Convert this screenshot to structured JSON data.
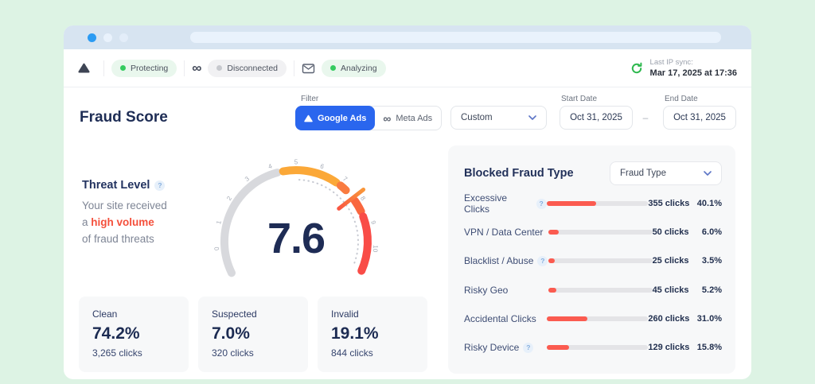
{
  "ui": {
    "help_glyph": "?"
  },
  "header": {
    "google": {
      "label": "Protecting"
    },
    "meta": {
      "label": "Disconnected"
    },
    "email": {
      "label": "Analyzing"
    },
    "sync": {
      "label": "Last IP sync:",
      "value": "Mar 17, 2025 at 17:36"
    }
  },
  "toolbar": {
    "title": "Fraud Score",
    "filter_label": "Filter",
    "tabs": [
      {
        "label": "Google Ads"
      },
      {
        "label": "Meta Ads"
      }
    ],
    "range": "Custom",
    "start_date": {
      "label": "Start Date",
      "value": "Oct 31, 2025"
    },
    "date_separator": "–",
    "end_date": {
      "label": "End Date",
      "value": "Oct 31, 2025"
    }
  },
  "threat": {
    "title": "Threat Level",
    "line1": "Your site received",
    "line2_prefix": "a",
    "line2_highlight": "high volume",
    "line3": "of fraud threats"
  },
  "gauge": {
    "value": "7.6",
    "min": 0,
    "max": 10,
    "tick_labels": [
      "0",
      "1",
      "2",
      "3",
      "4",
      "5",
      "6",
      "7",
      "8",
      "9",
      "10"
    ],
    "segments": [
      {
        "from": -1.1,
        "to": 4.2,
        "color": "#d8d9dd"
      },
      {
        "from": 4.45,
        "to": 6.8,
        "color": "#fba838"
      },
      {
        "from": 7.02,
        "to": 7.32,
        "color": "#f97b40"
      },
      {
        "from": 7.9,
        "to": 8.42,
        "color": "#f9673e"
      },
      {
        "from": 8.65,
        "to": 11.0,
        "color": "#f94c47"
      }
    ],
    "dotted": {
      "from": 5.15,
      "to": 10.9,
      "radius": 78
    },
    "needle": {
      "at": 7.75,
      "inner_color": "#f95642",
      "outer_color": "#f9973a"
    },
    "value_color": "#1e2c55"
  },
  "stats": [
    {
      "label": "Clean",
      "pct": "74.2%",
      "clicks": "3,265 clicks"
    },
    {
      "label": "Suspected",
      "pct": "7.0%",
      "clicks": "320 clicks"
    },
    {
      "label": "Invalid",
      "pct": "19.1%",
      "clicks": "844 clicks"
    }
  ],
  "fraud_panel": {
    "title": "Blocked Fraud Type",
    "dropdown": "Fraud Type",
    "bar_color": "#fb5b50",
    "rows": [
      {
        "label": "Excessive Clicks",
        "help": true,
        "clicks": "355 clicks",
        "pct": "40.1%",
        "fill_pct": 49
      },
      {
        "label": "VPN / Data Center",
        "help": false,
        "clicks": "50 clicks",
        "pct": "6.0%",
        "fill_pct": 10
      },
      {
        "label": "Blacklist / Abuse",
        "help": true,
        "clicks": "25 clicks",
        "pct": "3.5%",
        "fill_pct": 6
      },
      {
        "label": "Risky Geo",
        "help": false,
        "clicks": "45 clicks",
        "pct": "5.2%",
        "fill_pct": 8
      },
      {
        "label": "Accidental Clicks",
        "help": false,
        "clicks": "260 clicks",
        "pct": "31.0%",
        "fill_pct": 40
      },
      {
        "label": "Risky Device",
        "help": true,
        "clicks": "129 clicks",
        "pct": "15.8%",
        "fill_pct": 22
      }
    ]
  },
  "chart_data": [
    {
      "type": "gauge",
      "title": "Threat Level / Fraud Score",
      "value": 7.6,
      "min": 0,
      "max": 10
    },
    {
      "type": "bar",
      "title": "Blocked Fraud Type",
      "categories": [
        "Excessive Clicks",
        "VPN / Data Center",
        "Blacklist / Abuse",
        "Risky Geo",
        "Accidental Clicks",
        "Risky Device"
      ],
      "series": [
        {
          "name": "clicks",
          "values": [
            355,
            50,
            25,
            45,
            260,
            129
          ]
        },
        {
          "name": "percent",
          "values": [
            40.1,
            6.0,
            3.5,
            5.2,
            31.0,
            15.8
          ]
        }
      ]
    },
    {
      "type": "table",
      "title": "Traffic quality",
      "categories": [
        "Clean",
        "Suspected",
        "Invalid"
      ],
      "series": [
        {
          "name": "percent",
          "values": [
            74.2,
            7.0,
            19.1
          ]
        },
        {
          "name": "clicks",
          "values": [
            3265,
            320,
            844
          ]
        }
      ]
    }
  ]
}
